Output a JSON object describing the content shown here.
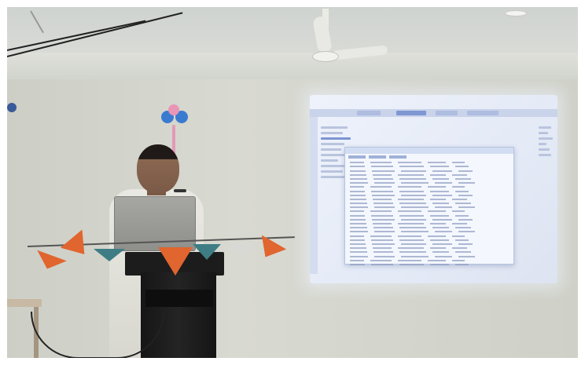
{
  "scene": {
    "description_label": "",
    "colors": {
      "wall": "#d6d7cf",
      "projection": "#e8edf8",
      "podium": "#1c1c1c",
      "bunting_orange": "#e0652e",
      "bunting_teal": "#3e7d84",
      "flower_blue": "#3a7bd0"
    }
  }
}
